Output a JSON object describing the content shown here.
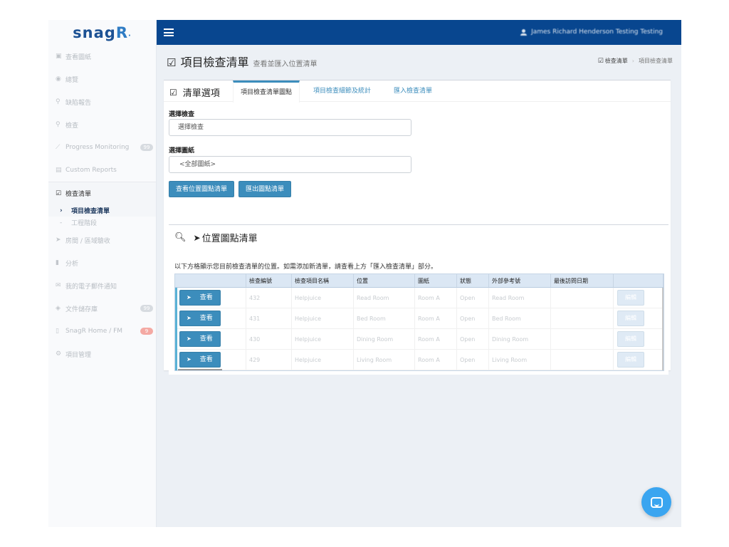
{
  "app": {
    "logo": "snag",
    "logo_r": "R",
    "logo_dot": "·"
  },
  "sidebar": {
    "items": [
      {
        "label": "查看圖紙",
        "icon": "image-icon"
      },
      {
        "label": "總覽",
        "icon": "dashboard-icon"
      },
      {
        "label": "缺陷報告",
        "icon": "map-marker-icon"
      },
      {
        "label": "檢查",
        "icon": "search-icon"
      },
      {
        "label": "Progress Monitoring",
        "icon": "line-chart-icon",
        "badge": "99"
      },
      {
        "label": "Custom Reports",
        "icon": "file-icon"
      },
      {
        "label": "檢查清單",
        "icon": "check-square-icon",
        "active": true
      },
      {
        "label": "房間 / 區域驗收",
        "icon": "location-arrow-icon"
      },
      {
        "label": "分析",
        "icon": "bar-chart-icon"
      },
      {
        "label": "我的電子郵件通知",
        "icon": "envelope-icon"
      },
      {
        "label": "文件儲存庫",
        "icon": "dropbox-icon",
        "badge": "99"
      },
      {
        "label": "SnagR Home / FM",
        "icon": "document-icon",
        "badge": "9"
      },
      {
        "label": "項目管理",
        "icon": "cogs-icon"
      }
    ],
    "sub_items": [
      {
        "label": "項目檢查清單",
        "active": true
      },
      {
        "label": "工程階段"
      }
    ]
  },
  "topbar": {
    "user_name": "James Richard Henderson Testing Testing"
  },
  "content_header": {
    "title": "項目檢查清單",
    "subtitle": "查看並匯入位置清單",
    "breadcrumb_home": "檢查清單",
    "breadcrumb_sep": "›",
    "breadcrumb_current": "項目檢查清單"
  },
  "panel": {
    "header": "清單選項",
    "tabs": [
      "項目檢查清單圖點",
      "項目檢查細節及統計",
      "匯入檢查清單"
    ],
    "inspection_label": "選擇檢查",
    "inspection_value": "選擇檢查",
    "drawing_label": "選擇圖紙",
    "drawing_value": "<全部圖紙>",
    "btn_view": "查看位置圖點清單",
    "btn_export": "匯出圖點清單"
  },
  "list": {
    "title": "位置圖點清單",
    "description": "以下方格顯示您目前檢查清單的位置。如需添加新清單，請查看上方「匯入檢查清單」部分。",
    "columns": [
      "",
      "檢查編號",
      "檢查項目名稱",
      "位置",
      "圖紙",
      "狀態",
      "外部參考號",
      "最後訪問日期",
      ""
    ],
    "view_label": "查看",
    "edit_label": "編輯",
    "rows": [
      [
        "432",
        "Helpjuice",
        "Read Room",
        "Room A",
        "Open",
        "Read Room",
        ""
      ],
      [
        "431",
        "Helpjuice",
        "Bed Room",
        "Room A",
        "Open",
        "Bed Room",
        ""
      ],
      [
        "430",
        "Helpjuice",
        "Dining Room",
        "Room A",
        "Open",
        "Dining Room",
        ""
      ],
      [
        "429",
        "Helpjuice",
        "Living Room",
        "Room A",
        "Open",
        "Living Room",
        ""
      ]
    ]
  },
  "colors": {
    "topbar": "#08468f",
    "primary": "#3c8dbc",
    "chat": "#3aa5f0"
  }
}
